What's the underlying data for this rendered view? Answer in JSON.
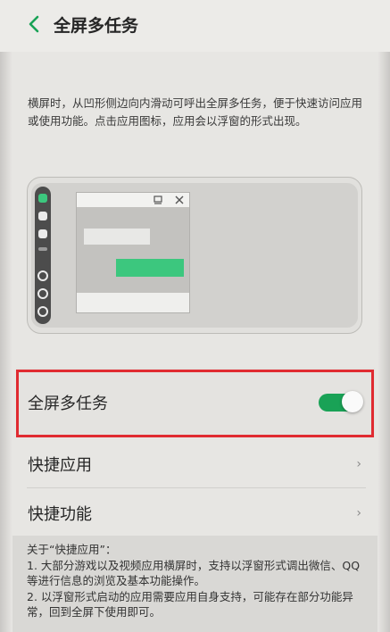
{
  "header": {
    "title": "全屏多任务"
  },
  "description": "横屏时，从凹形侧边向内滑动可呼出全屏多任务，便于快速访问应用或使用功能。点击应用图标，应用会以浮窗的形式出现。",
  "settings": {
    "fullscreen_multitask": {
      "label": "全屏多任务",
      "enabled": true
    },
    "shortcut_apps": {
      "label": "快捷应用"
    },
    "shortcut_functions": {
      "label": "快捷功能"
    }
  },
  "notes": {
    "heading": "关于“快捷应用”：",
    "line1": "1. 大部分游戏以及视频应用横屏时，支持以浮窗形式调出微信、QQ等进行信息的浏览及基本功能操作。",
    "line2": "2. 以浮窗形式启动的应用需要应用自身支持，可能存在部分功能异常，回到全屏下使用即可。"
  },
  "colors": {
    "accent_green": "#19a256",
    "highlight_red": "#e02b31",
    "illustration_green": "#3cc77e"
  }
}
